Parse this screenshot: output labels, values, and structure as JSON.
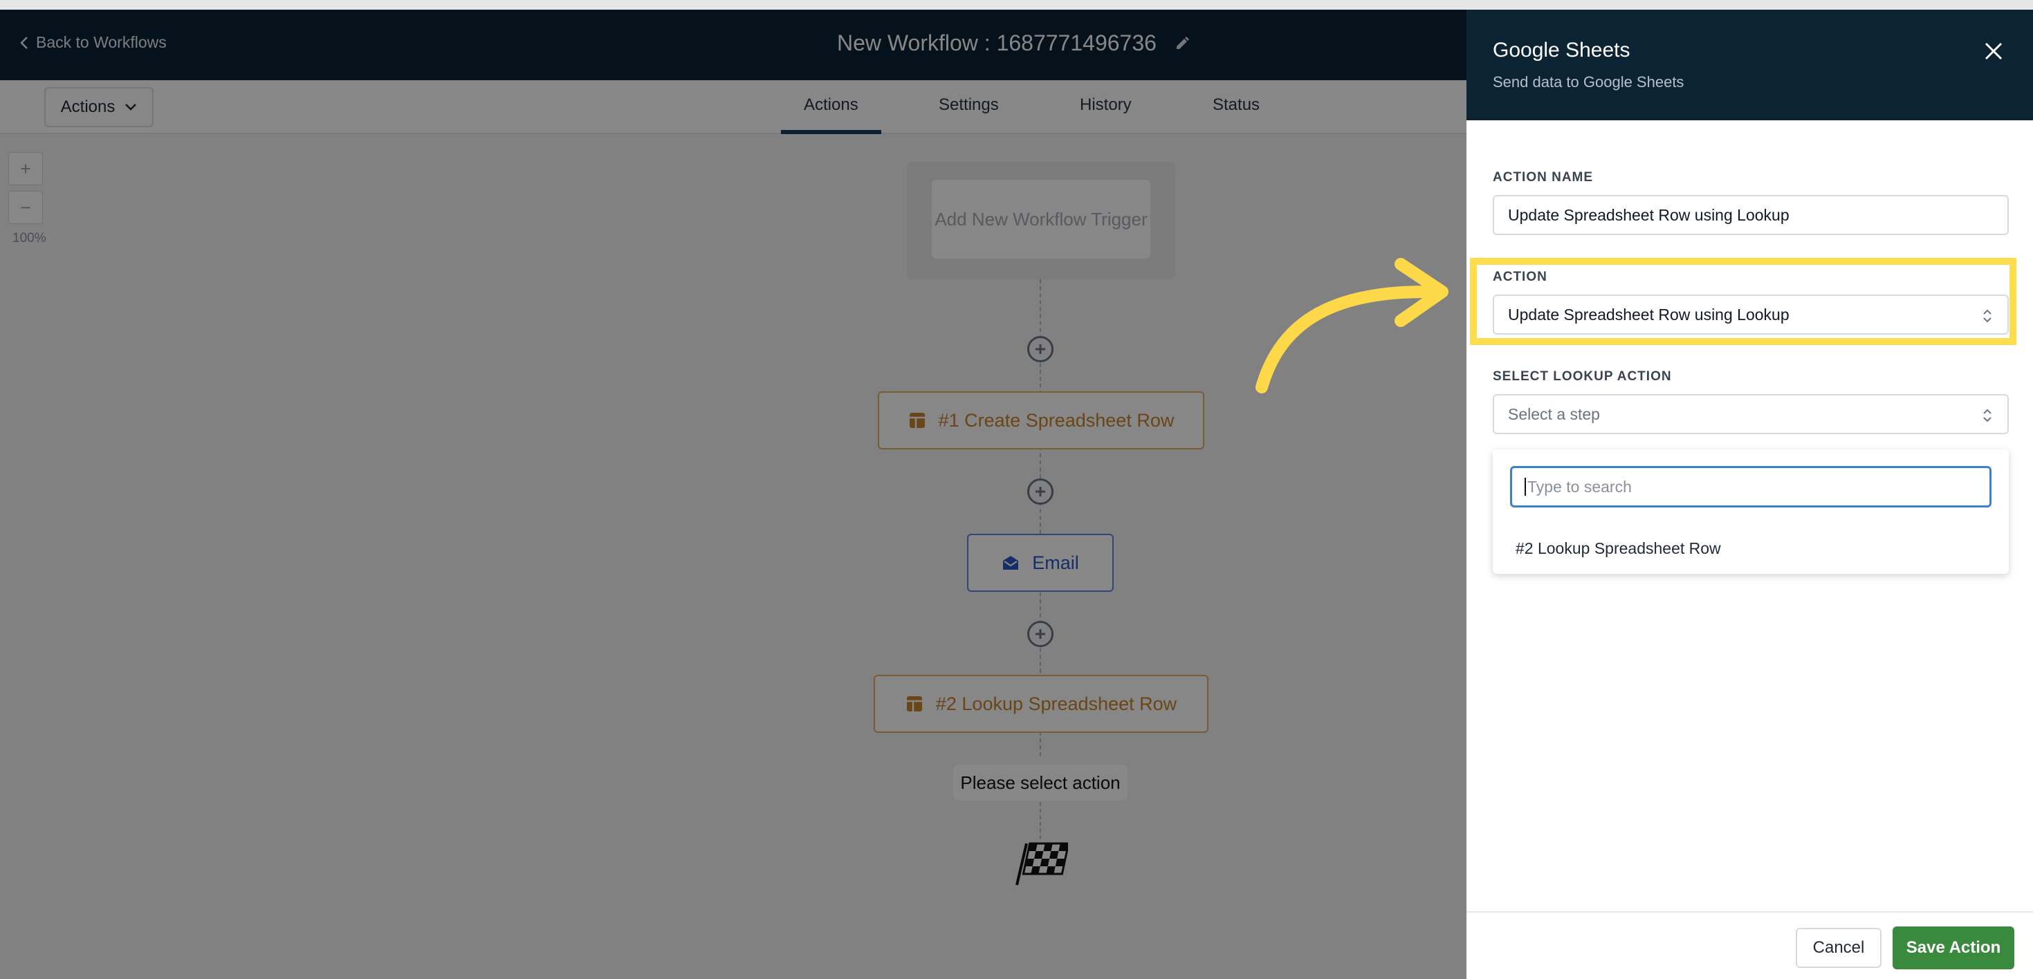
{
  "header": {
    "back_label": "Back to Workflows",
    "workflow_title": "New Workflow : 1687771496736"
  },
  "toolbar": {
    "actions_dropdown_label": "Actions",
    "tabs": [
      {
        "label": "Actions",
        "active": true
      },
      {
        "label": "Settings",
        "active": false
      },
      {
        "label": "History",
        "active": false
      },
      {
        "label": "Status",
        "active": false
      }
    ]
  },
  "canvas": {
    "zoom_in_label": "+",
    "zoom_out_label": "−",
    "zoom_level": "100%",
    "trigger_label": "Add New Workflow Trigger",
    "nodes": [
      {
        "label": "#1 Create Spreadsheet Row",
        "kind": "sheet",
        "icon": "spreadsheet-icon"
      },
      {
        "label": "Email",
        "kind": "email",
        "icon": "email-icon"
      },
      {
        "label": "#2 Lookup Spreadsheet Row",
        "kind": "sheet",
        "icon": "spreadsheet-icon"
      }
    ],
    "end_label": "Please select action",
    "end_icon": "finish-flag-icon"
  },
  "drawer": {
    "title": "Google Sheets",
    "subtitle": "Send data to Google Sheets",
    "action_name_label": "ACTION NAME",
    "action_name_value": "Update Spreadsheet Row using Lookup",
    "action_label": "ACTION",
    "action_value": "Update Spreadsheet Row using Lookup",
    "lookup_label": "SELECT LOOKUP ACTION",
    "lookup_placeholder": "Select a step",
    "search_placeholder": "Type to search",
    "options": [
      "#2 Lookup Spreadsheet Row"
    ],
    "cancel_label": "Cancel",
    "save_label": "Save Action"
  },
  "colors": {
    "header_bg": "#0c2333",
    "highlight": "#fddd4e",
    "save_button": "#3a8a3d",
    "sheet_node": "#c6822c",
    "email_node": "#2b55c2"
  }
}
